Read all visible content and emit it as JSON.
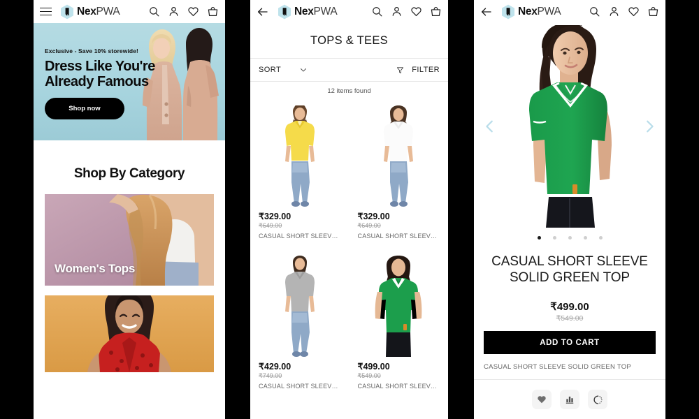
{
  "brand": {
    "bold": "Nex",
    "light": "PWA"
  },
  "appbar": {
    "menu_icon": "hamburger-icon",
    "back_icon": "back-arrow-icon",
    "search_icon": "search-icon",
    "account_icon": "account-icon",
    "wishlist_icon": "heart-icon",
    "cart_icon": "basket-icon"
  },
  "home": {
    "hero": {
      "kicker": "Exclusive - Save 10% storewide!",
      "title_line1": "Dress Like You're",
      "title_line2": "Already Famous",
      "cta": "Shop now",
      "bg_color": "#a8d5df"
    },
    "section_title": "Shop By Category",
    "categories": [
      {
        "label": "Women's Tops",
        "bg_color": "#b189a0"
      },
      {
        "label": "",
        "bg_color": "#dfa251"
      }
    ]
  },
  "plp": {
    "title": "TOPS & TEES",
    "sort_label": "SORT",
    "sort_caret_icon": "chevron-down-icon",
    "filter_label": "FILTER",
    "filter_icon": "funnel-icon",
    "items_found": "12 items found",
    "products": [
      {
        "price": "₹329.00",
        "price_old": "₹649.00",
        "name": "CASUAL SHORT SLEEV…",
        "color": "#f5db4a"
      },
      {
        "price": "₹329.00",
        "price_old": "₹649.00",
        "name": "CASUAL SHORT SLEEV…",
        "color": "#fbfbfb"
      },
      {
        "price": "₹429.00",
        "price_old": "₹749.00",
        "name": "CASUAL SHORT SLEEV…",
        "color": "#b4b4b4"
      },
      {
        "price": "₹499.00",
        "price_old": "₹549.00",
        "name": "CASUAL SHORT SLEEV…",
        "color": "#1c9e4c"
      }
    ]
  },
  "pdp": {
    "title": "CASUAL SHORT SLEEVE SOLID GREEN TOP",
    "price": "₹499.00",
    "price_old": "₹549.00",
    "add_to_cart": "ADD TO CART",
    "subtitle": "CASUAL SHORT SLEEVE SOLID GREEN TOP",
    "prev_icon": "chevron-left-icon",
    "next_icon": "chevron-right-icon",
    "dots_total": 5,
    "dots_active": 1,
    "product_color": "#1c9e4c",
    "actions": [
      {
        "icon": "heart-filled-icon"
      },
      {
        "icon": "compare-bars-icon"
      },
      {
        "icon": "refresh-dotted-icon"
      }
    ]
  }
}
